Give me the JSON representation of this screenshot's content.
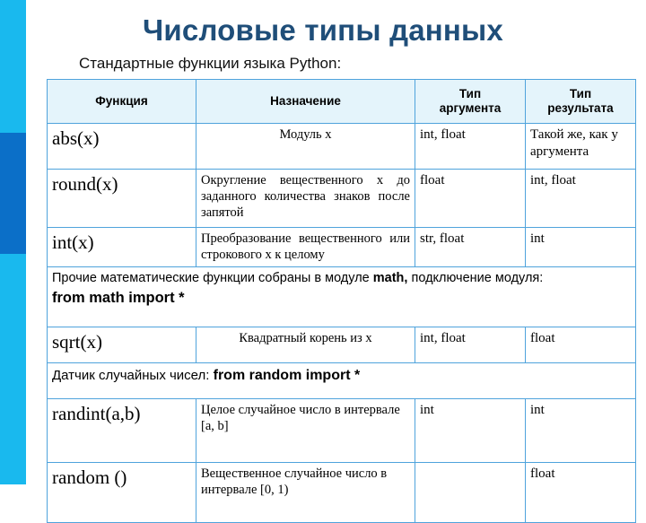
{
  "slide": {
    "title": "Числовые типы данных",
    "subtitle": "Стандартные функции языка Python:",
    "title_color": "#1F4E79",
    "accent_cyan": "#19B9EE",
    "accent_blue": "#0B6FC8",
    "table_border_color": "#4FA3DC",
    "header_fill": "#E4F4FB"
  },
  "table": {
    "headers": [
      "Функция",
      "Назначение",
      "Тип\nаргумента",
      "Тип\nрезультата"
    ],
    "headers_plain": {
      "function": "Функция",
      "purpose": "Назначение",
      "arg_type_line1": "Тип",
      "arg_type_line2": "аргумента",
      "result_type_line1": "Тип",
      "result_type_line2": "результата"
    },
    "rows": [
      {
        "type": "data",
        "function": "abs(x)",
        "purpose": "Модуль x",
        "arg_type": "int, float",
        "result_type": "Такой же, как у аргумента"
      },
      {
        "type": "data",
        "function": "round(x)",
        "purpose": "Округление вещественного x до заданного количества знаков после запятой",
        "arg_type": "float",
        "result_type": "int, float"
      },
      {
        "type": "data",
        "function": "int(x)",
        "purpose": "Преобразование вещественного или строкового x к целому",
        "arg_type": "str, float",
        "result_type": "int"
      },
      {
        "type": "note",
        "text_before": "Прочие математические функции собраны в модуле ",
        "module": "math,",
        "text_after": " подключение модуля:",
        "code": "from math import *"
      },
      {
        "type": "data",
        "function": "sqrt(x)",
        "purpose": "Квадратный корень из x",
        "arg_type": "int, float",
        "result_type": "float"
      },
      {
        "type": "note_inline",
        "label": "Датчик случайных чисел:",
        "code": "from random import *"
      },
      {
        "type": "data",
        "function": "randint(a,b)",
        "purpose": "Целое случайное число в интервале [a, b]",
        "arg_type": "int",
        "result_type": "int"
      },
      {
        "type": "data",
        "function": "random ()",
        "purpose": "Вещественное случайное число в интервале  [0, 1)",
        "arg_type": "",
        "result_type": "float"
      }
    ]
  }
}
